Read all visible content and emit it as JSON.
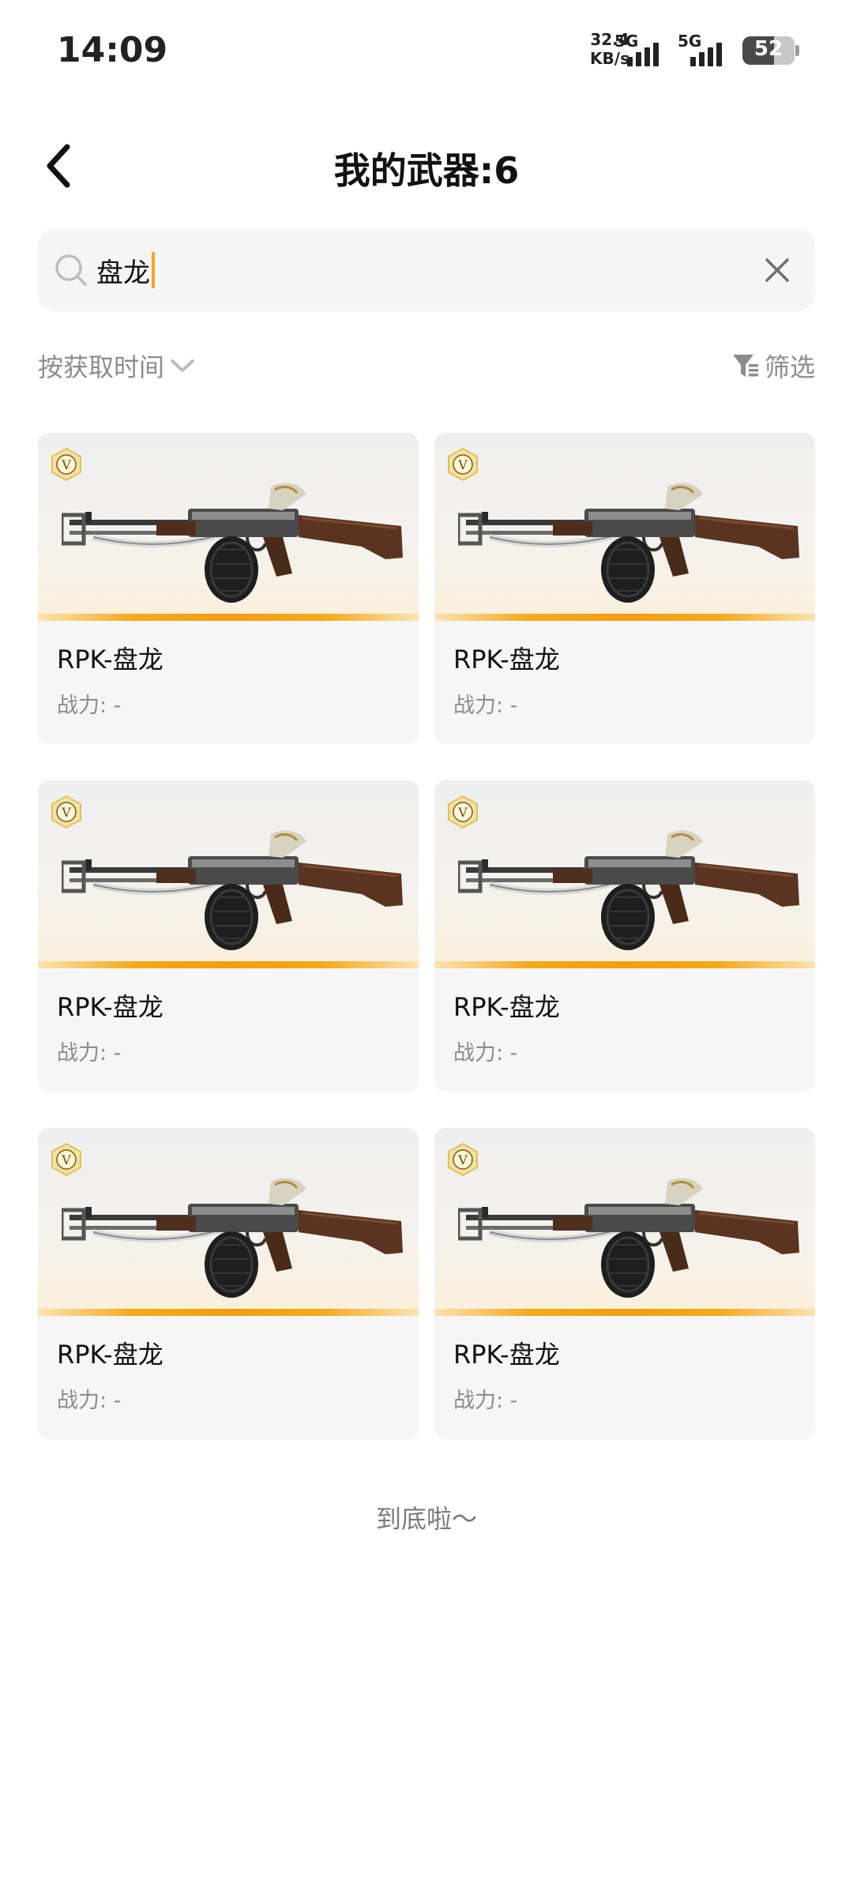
{
  "status_bar": {
    "time": "14:09",
    "net_speed_value": "32.4",
    "net_speed_unit": "KB/s",
    "sim1_label": "5G",
    "sim2_label": "5G",
    "battery_level": "52"
  },
  "header": {
    "title": "我的武器:6"
  },
  "search": {
    "value": "盘龙"
  },
  "toolbar": {
    "sort_label": "按获取时间",
    "filter_label": "筛选"
  },
  "weapons": [
    {
      "name": "RPK-盘龙",
      "power": "战力: -"
    },
    {
      "name": "RPK-盘龙",
      "power": "战力: -"
    },
    {
      "name": "RPK-盘龙",
      "power": "战力: -"
    },
    {
      "name": "RPK-盘龙",
      "power": "战力: -"
    },
    {
      "name": "RPK-盘龙",
      "power": "战力: -"
    },
    {
      "name": "RPK-盘龙",
      "power": "战力: -"
    }
  ],
  "footer": {
    "end_text": "到底啦～"
  },
  "colors": {
    "accent": "#f5a623",
    "muted_text": "#8c8c8c"
  }
}
